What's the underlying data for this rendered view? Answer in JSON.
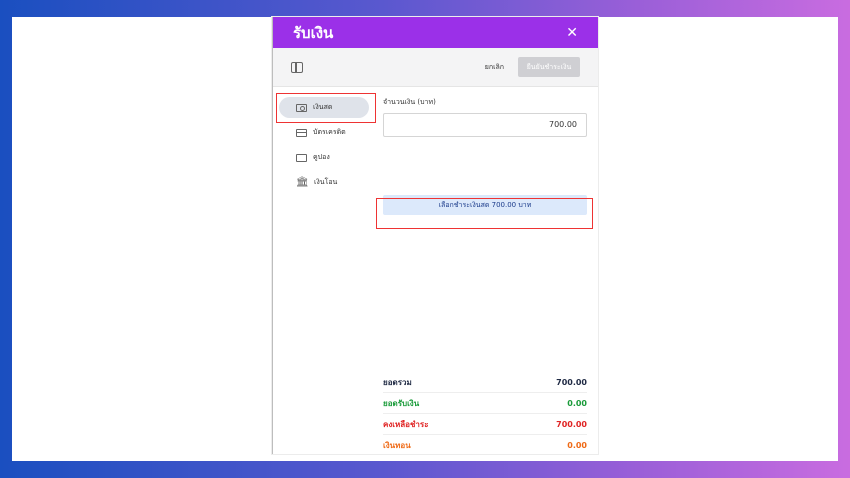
{
  "modal": {
    "title": "รับเงิน",
    "close_symbol": "✕"
  },
  "toolbar": {
    "cancel_label": "ยกเลิก",
    "confirm_label": "ยืนยันชำระเงิน"
  },
  "sidebar": {
    "items": [
      {
        "label": "เงินสด",
        "icon": "cash-icon",
        "active": true
      },
      {
        "label": "บัตรเครดิต",
        "icon": "credit-card-icon",
        "active": false
      },
      {
        "label": "คูปอง",
        "icon": "coupon-icon",
        "active": false
      },
      {
        "label": "เงินโอน",
        "icon": "bank-icon",
        "active": false
      }
    ]
  },
  "payment": {
    "amount_label": "จำนวนเงิน (บาท)",
    "amount_value": "700.00",
    "select_button_label": "เลือกชำระเงินสด 700.00 บาท"
  },
  "summary": {
    "total_label": "ยอดรวม",
    "total_value": "700.00",
    "received_label": "ยอดรับเงิน",
    "received_value": "0.00",
    "remaining_label": "คงเหลือชำระ",
    "remaining_value": "700.00",
    "change_label": "เงินทอน",
    "change_value": "0.00"
  },
  "colors": {
    "header": "#9b30e8",
    "highlight": "#e33333",
    "received": "#1a9b3a",
    "remaining": "#e02424",
    "change": "#ef6a16"
  }
}
